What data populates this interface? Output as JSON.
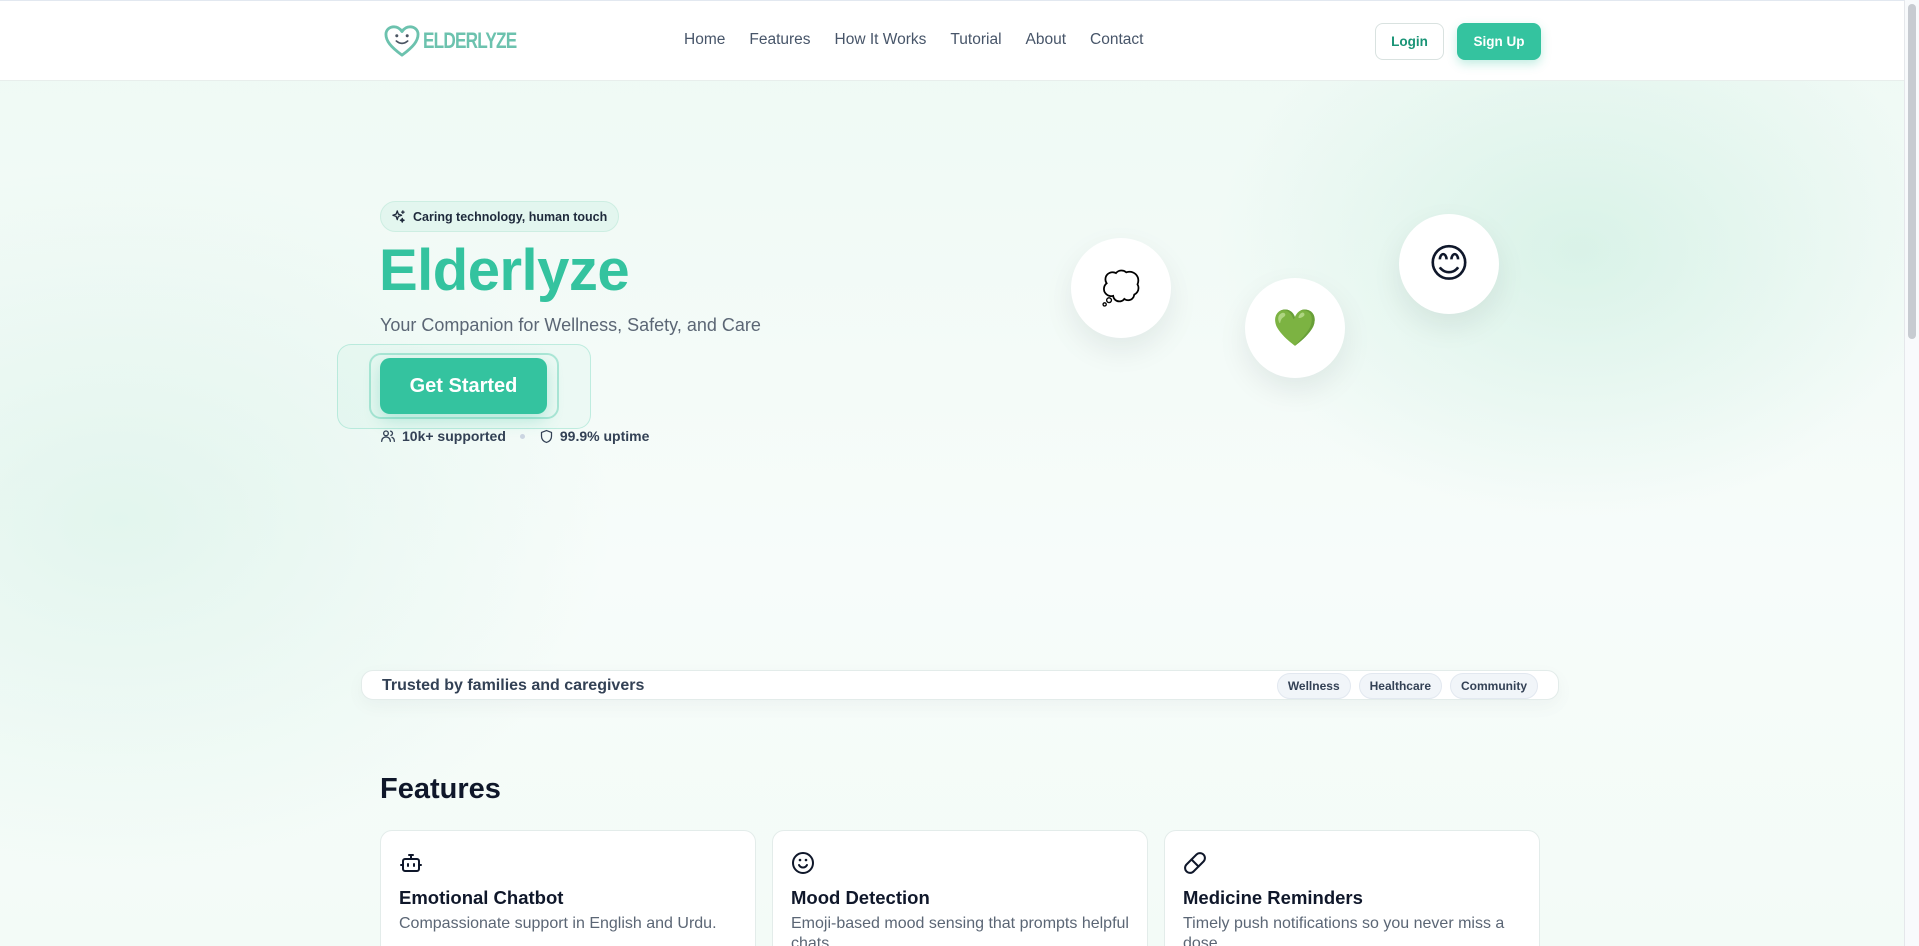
{
  "header": {
    "logo_text": "ELDERLYZE",
    "nav": [
      "Home",
      "Features",
      "How It Works",
      "Tutorial",
      "About",
      "Contact"
    ],
    "login_label": "Login",
    "signup_label": "Sign Up"
  },
  "hero": {
    "pill": "Caring technology, human touch",
    "title": "Elderlyze",
    "subtitle": "Your Companion for Wellness, Safety, and Care",
    "cta": "Get Started",
    "stats": [
      {
        "icon": "users-icon",
        "label": "10k+ supported"
      },
      {
        "icon": "shield-icon",
        "label": "99.9% uptime"
      }
    ],
    "bubbles": [
      {
        "icon": "speech-bubble-icon",
        "glyph": "💭"
      },
      {
        "icon": "green-heart-icon",
        "glyph": "💚"
      },
      {
        "icon": "smiling-face-icon",
        "glyph": "😊"
      }
    ]
  },
  "trusted": {
    "text": "Trusted by families and caregivers",
    "tags": [
      "Wellness",
      "Healthcare",
      "Community"
    ]
  },
  "features": {
    "title": "Features",
    "cards": [
      {
        "icon": "robot-icon",
        "title": "Emotional Chatbot",
        "desc": "Compassionate support in English and Urdu."
      },
      {
        "icon": "smile-icon",
        "title": "Mood Detection",
        "desc": "Emoji-based mood sensing that prompts helpful chats."
      },
      {
        "icon": "pill-icon",
        "title": "Medicine Reminders",
        "desc": "Timely push notifications so you never miss a dose."
      }
    ]
  },
  "colors": {
    "brand": "#34c39f",
    "brand_dark": "#199476",
    "text": "#0f172a",
    "muted": "#5b6675"
  }
}
